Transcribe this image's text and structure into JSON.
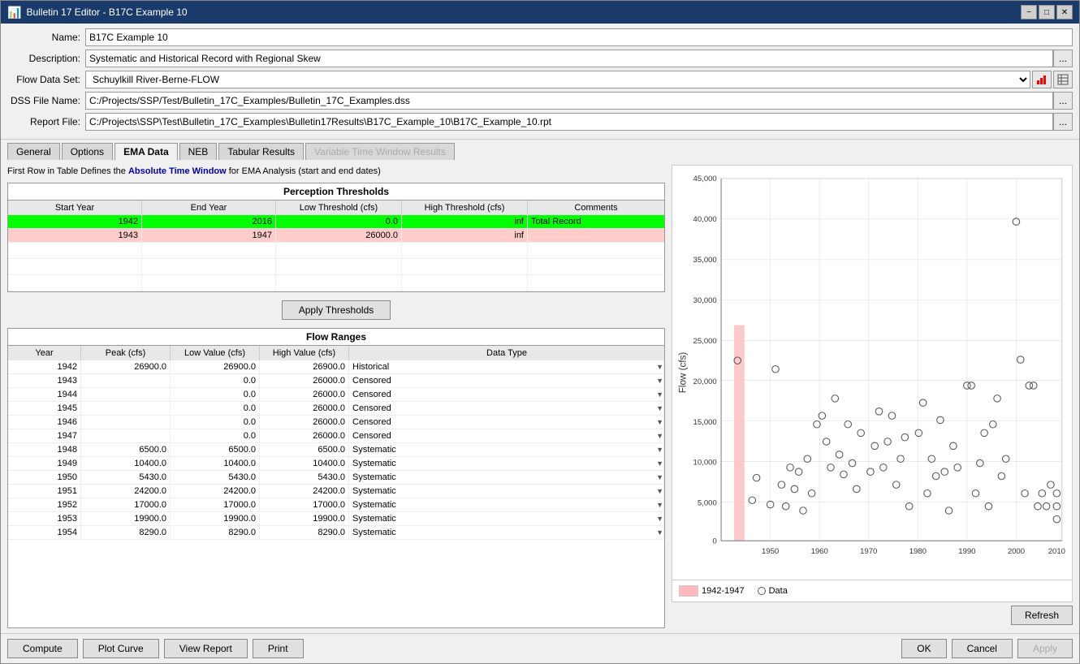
{
  "window": {
    "title": "Bulletin 17 Editor - B17C Example 10",
    "icon": "📊"
  },
  "form": {
    "name_label": "Name:",
    "name_value": "B17C Example 10",
    "description_label": "Description:",
    "description_value": "Systematic and Historical Record with Regional Skew",
    "flow_data_set_label": "Flow Data Set:",
    "flow_data_set_value": "Schuylkill River-Berne-FLOW",
    "dss_file_label": "DSS File Name:",
    "dss_file_value": "C:/Projects/SSP/Test/Bulletin_17C_Examples/Bulletin_17C_Examples.dss",
    "report_file_label": "Report File:",
    "report_file_value": "C:/Projects\\SSP\\Test\\Bulletin_17C_Examples\\Bulletin17Results\\B17C_Example_10\\B17C_Example_10.rpt"
  },
  "tabs": [
    {
      "label": "General",
      "active": false,
      "disabled": false
    },
    {
      "label": "Options",
      "active": false,
      "disabled": false
    },
    {
      "label": "EMA Data",
      "active": true,
      "disabled": false
    },
    {
      "label": "NEB",
      "active": false,
      "disabled": false
    },
    {
      "label": "Tabular Results",
      "active": false,
      "disabled": false
    },
    {
      "label": "Variable Time Window Results",
      "active": false,
      "disabled": true
    }
  ],
  "ema_info_text": "First Row in Table Defines the Absolute Time Window for EMA Analysis (start and end dates)",
  "ema_info_bold": "Absolute Time Window",
  "perception_table": {
    "section_header": "Perception Thresholds",
    "columns": [
      "Start Year",
      "End Year",
      "Low Threshold (cfs)",
      "High Threshold (cfs)",
      "Comments"
    ],
    "rows": [
      {
        "start": "1942",
        "end": "2016",
        "low": "0.0",
        "high": "inf",
        "comment": "Total Record",
        "style": "green"
      },
      {
        "start": "1943",
        "end": "1947",
        "low": "26000.0",
        "high": "inf",
        "comment": "",
        "style": "pink"
      },
      {
        "start": "",
        "end": "",
        "low": "",
        "high": "",
        "comment": "",
        "style": "empty"
      },
      {
        "start": "",
        "end": "",
        "low": "",
        "high": "",
        "comment": "",
        "style": "empty"
      },
      {
        "start": "",
        "end": "",
        "low": "",
        "high": "",
        "comment": "",
        "style": "empty"
      }
    ]
  },
  "apply_thresholds_btn": "Apply Thresholds",
  "flow_ranges_table": {
    "section_header": "Flow Ranges",
    "columns": [
      "Year",
      "Peak (cfs)",
      "Low Value (cfs)",
      "High Value (cfs)",
      "Data Type"
    ],
    "rows": [
      {
        "year": "1942",
        "peak": "26900.0",
        "low": "26900.0",
        "high": "26900.0",
        "dtype": "Historical"
      },
      {
        "year": "1943",
        "peak": "",
        "low": "0.0",
        "high": "26000.0",
        "dtype": "Censored"
      },
      {
        "year": "1944",
        "peak": "",
        "low": "0.0",
        "high": "26000.0",
        "dtype": "Censored"
      },
      {
        "year": "1945",
        "peak": "",
        "low": "0.0",
        "high": "26000.0",
        "dtype": "Censored"
      },
      {
        "year": "1946",
        "peak": "",
        "low": "0.0",
        "high": "26000.0",
        "dtype": "Censored"
      },
      {
        "year": "1947",
        "peak": "",
        "low": "0.0",
        "high": "26000.0",
        "dtype": "Censored"
      },
      {
        "year": "1948",
        "peak": "6500.0",
        "low": "6500.0",
        "high": "6500.0",
        "dtype": "Systematic"
      },
      {
        "year": "1949",
        "peak": "10400.0",
        "low": "10400.0",
        "high": "10400.0",
        "dtype": "Systematic"
      },
      {
        "year": "1950",
        "peak": "5430.0",
        "low": "5430.0",
        "high": "5430.0",
        "dtype": "Systematic"
      },
      {
        "year": "1951",
        "peak": "24200.0",
        "low": "24200.0",
        "high": "24200.0",
        "dtype": "Systematic"
      },
      {
        "year": "1952",
        "peak": "17000.0",
        "low": "17000.0",
        "high": "17000.0",
        "dtype": "Systematic"
      },
      {
        "year": "1953",
        "peak": "19900.0",
        "low": "19900.0",
        "high": "19900.0",
        "dtype": "Systematic"
      },
      {
        "year": "1954",
        "peak": "8290.0",
        "low": "8290.0",
        "high": "8290.0",
        "dtype": "Systematic"
      }
    ]
  },
  "chart": {
    "title": "",
    "y_label": "Flow (cfs)",
    "y_ticks": [
      "0",
      "5,000",
      "10,000",
      "15,000",
      "20,000",
      "25,000",
      "30,000",
      "35,000",
      "40,000",
      "45,000"
    ],
    "x_ticks": [
      "1950",
      "1960",
      "1970",
      "1980",
      "1990",
      "2000",
      "2010"
    ],
    "legend_pink_label": "1942-1947",
    "legend_circle_label": "Data"
  },
  "refresh_btn": "Refresh",
  "bottom_buttons": {
    "compute": "Compute",
    "plot_curve": "Plot Curve",
    "view_report": "View Report",
    "print": "Print",
    "ok": "OK",
    "cancel": "Cancel",
    "apply": "Apply"
  },
  "title_controls": {
    "minimize": "−",
    "maximize": "□",
    "close": "✕"
  }
}
